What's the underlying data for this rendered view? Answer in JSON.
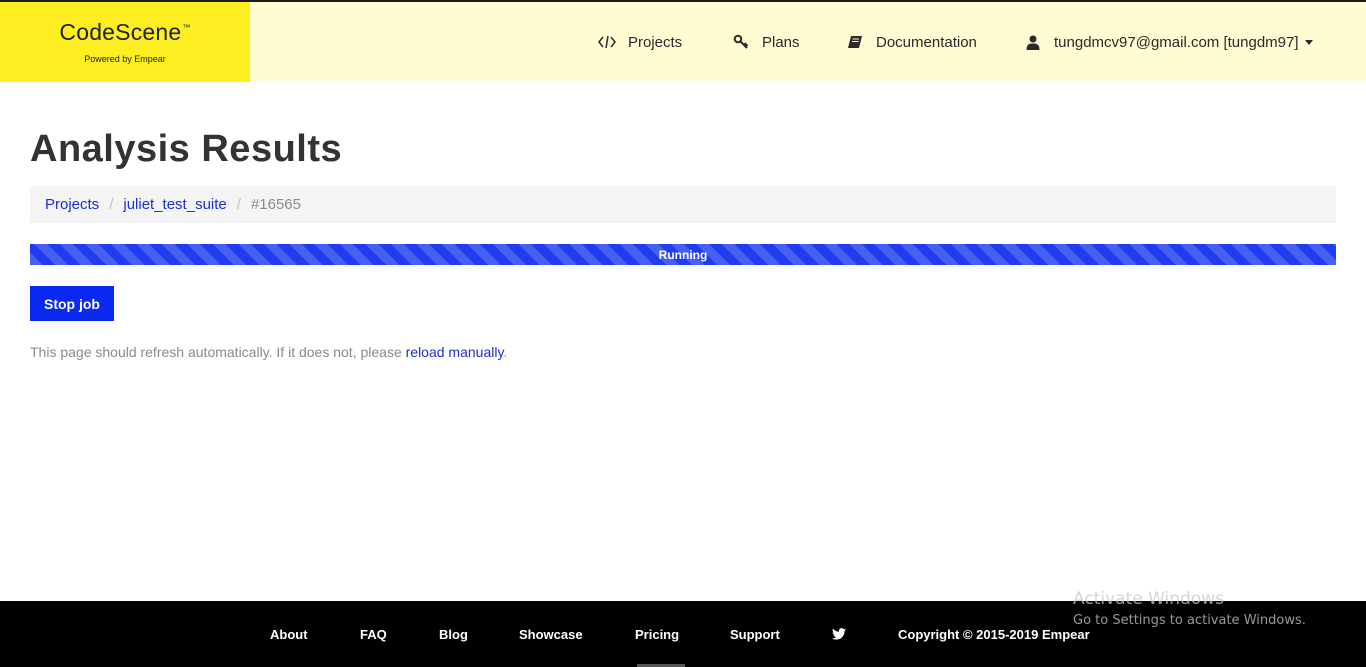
{
  "header": {
    "logo": {
      "name": "CodeScene",
      "trademark": "™",
      "tagline": "Powered by Empear"
    },
    "nav": {
      "projects_label": "Projects",
      "plans_label": "Plans",
      "documentation_label": "Documentation",
      "user_label": "tungdmcv97@gmail.com [tungdm97]"
    },
    "icons": [
      "code-icon",
      "key-icon",
      "book-icon",
      "user-icon",
      "caret-down-icon"
    ]
  },
  "main": {
    "title": "Analysis Results",
    "breadcrumb": {
      "items": [
        "Projects",
        "juliet_test_suite"
      ],
      "current": "#16565",
      "separator": "/"
    },
    "progress": {
      "label": "Running",
      "value_percent": 100,
      "color": "#1f3cf0"
    },
    "stop_button_label": "Stop job",
    "refresh_note": {
      "text": "This page should refresh automatically. If it does not, please ",
      "link_text": "reload manually",
      "suffix": "."
    }
  },
  "footer": {
    "links": [
      "About",
      "FAQ",
      "Blog",
      "Showcase",
      "Pricing",
      "Support"
    ],
    "twitter_icon": "twitter-icon",
    "copyright": "Copyright © 2015-2019 Empear"
  },
  "watermark": {
    "title": "Activate Windows",
    "subtitle": "Go to Settings to activate Windows."
  },
  "colors": {
    "logo_bg": "#fcee21",
    "header_bg": "#fffbd3",
    "accent": "#0a28f0",
    "link": "#1a2fd6",
    "footer_bg": "#000000"
  }
}
